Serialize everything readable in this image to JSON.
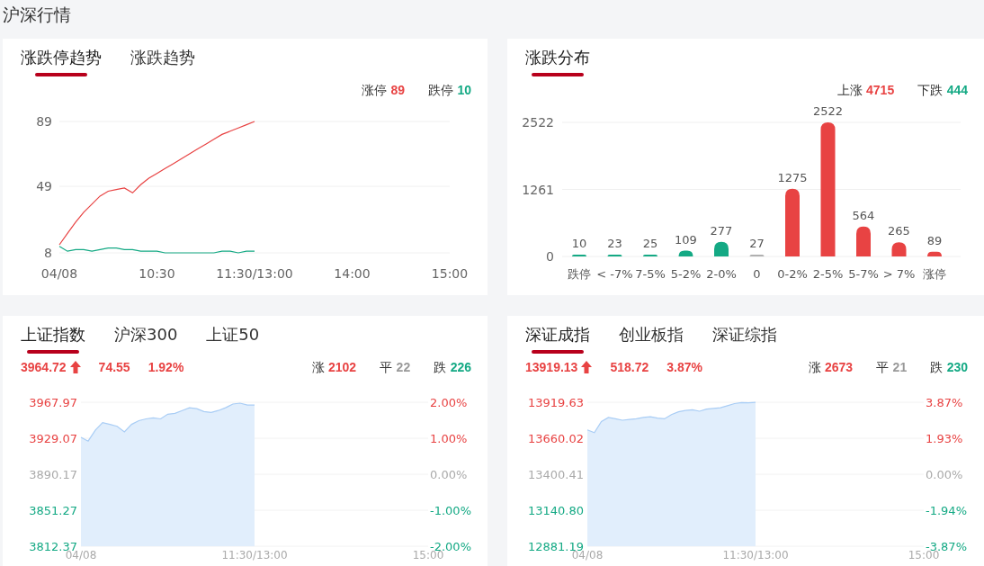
{
  "page_title": "沪深行情",
  "limit_panel": {
    "tabs": [
      {
        "label": "涨跌停趋势",
        "selected": true
      },
      {
        "label": "涨跌趋势",
        "selected": false
      }
    ],
    "legend": [
      {
        "label": "涨停",
        "value": "89",
        "color": "#e84343"
      },
      {
        "label": "跌停",
        "value": "10",
        "color": "#14a984"
      }
    ],
    "chart_data": {
      "type": "line",
      "categories": [
        "04/08",
        null,
        null,
        null,
        null,
        null,
        null,
        null,
        null,
        null,
        null,
        null,
        "10:30",
        null,
        null,
        null,
        null,
        null,
        null,
        null,
        null,
        null,
        null,
        null,
        "11:30/13:00",
        null,
        null,
        null,
        null,
        null,
        null,
        null,
        null,
        null,
        null,
        null,
        "14:00",
        null,
        null,
        null,
        null,
        null,
        null,
        null,
        null,
        null,
        null,
        null,
        "15:00"
      ],
      "series": [
        {
          "color": "#e84343",
          "values": [
            13,
            20,
            27,
            33,
            38,
            43,
            46,
            47,
            48,
            45,
            50,
            54,
            57,
            60,
            63,
            66,
            69,
            72,
            75,
            78,
            81,
            83,
            85,
            87,
            89,
            null,
            null,
            null,
            null,
            null,
            null,
            null,
            null,
            null,
            null,
            null,
            null,
            null,
            null,
            null,
            null,
            null,
            null,
            null,
            null,
            null,
            null,
            null,
            null
          ]
        },
        {
          "color": "#14a984",
          "values": [
            12,
            9,
            10,
            10,
            9,
            10,
            11,
            11,
            10,
            10,
            9,
            9,
            9,
            8,
            8,
            8,
            8,
            8,
            8,
            8,
            9,
            9,
            8,
            9,
            9,
            null,
            null,
            null,
            null,
            null,
            null,
            null,
            null,
            null,
            null,
            null,
            null,
            null,
            null,
            null,
            null,
            null,
            null,
            null,
            null,
            null,
            null,
            null,
            null
          ]
        }
      ],
      "ylim": [
        8,
        89
      ],
      "yticks": [
        8,
        49,
        89
      ],
      "grid": true
    }
  },
  "distribution_panel": {
    "tabs": [
      {
        "label": "涨跌分布",
        "selected": true
      }
    ],
    "legend": [
      {
        "label": "上涨",
        "value": "4715",
        "color": "#e84343"
      },
      {
        "label": "下跌",
        "value": "444",
        "color": "#14a984"
      }
    ],
    "chart_data": {
      "type": "bar",
      "categories": [
        "跌停",
        "< -7%",
        "7-5%",
        "5-2%",
        "2-0%",
        "0",
        "0-2%",
        "2-5%",
        "5-7%",
        "> 7%",
        "涨停"
      ],
      "series": [
        {
          "color": "#14a984",
          "values": [
            10,
            23,
            25,
            109,
            277,
            null,
            null,
            null,
            null,
            null,
            null
          ]
        },
        {
          "color": "#b0b0b0",
          "values": [
            null,
            null,
            null,
            null,
            null,
            27,
            null,
            null,
            null,
            null,
            null
          ]
        },
        {
          "color": "#e84343",
          "values": [
            null,
            null,
            null,
            null,
            null,
            null,
            1275,
            2522,
            564,
            265,
            89
          ]
        }
      ],
      "stacked": true,
      "data_labels": true,
      "grid": true,
      "ylim": [
        0,
        2522
      ],
      "yticks": [
        0,
        1261,
        2522
      ]
    }
  },
  "index_panels": [
    {
      "tabs": [
        {
          "label": "上证指数",
          "selected": true
        },
        {
          "label": "沪深300",
          "selected": false
        },
        {
          "label": "上证50",
          "selected": false
        }
      ],
      "quote": {
        "price": "3964.72",
        "rising": true,
        "change": "74.55",
        "percent": "1.92%"
      },
      "breadth": [
        {
          "label": "涨",
          "value": "2102",
          "color": "#e84343"
        },
        {
          "label": "平",
          "value": "22",
          "color": "#999999"
        },
        {
          "label": "跌",
          "value": "226",
          "color": "#14a984"
        }
      ],
      "right_axis_labels": [
        "2.00%",
        "1.00%",
        "0.00%",
        "-1.00%",
        "-2.00%"
      ],
      "chart_data": {
        "type": "area",
        "categories": [
          "04/08",
          null,
          null,
          null,
          null,
          null,
          null,
          null,
          null,
          null,
          null,
          null,
          null,
          null,
          null,
          null,
          null,
          null,
          null,
          null,
          null,
          null,
          null,
          null,
          "11:30/13:00",
          null,
          null,
          null,
          null,
          null,
          null,
          null,
          null,
          null,
          null,
          null,
          null,
          null,
          null,
          null,
          null,
          null,
          null,
          null,
          null,
          null,
          null,
          null,
          "15:00"
        ],
        "series": [
          {
            "color": "#a9cdf5",
            "values": [
              3930,
              3926,
              3938,
              3946,
              3944,
              3942,
              3936,
              3944,
              3948,
              3950,
              3951,
              3950,
              3955,
              3956,
              3959,
              3962,
              3961,
              3958,
              3957,
              3959,
              3962,
              3966,
              3967,
              3965,
              3965,
              null,
              null,
              null,
              null,
              null,
              null,
              null,
              null,
              null,
              null,
              null,
              null,
              null,
              null,
              null,
              null,
              null,
              null,
              null,
              null,
              null,
              null,
              null,
              null
            ]
          }
        ],
        "grid": true,
        "ylim": [
          3812.37,
          3967.97
        ],
        "yticks": [
          {
            "value": 3812.37,
            "label": "3812.37"
          },
          {
            "value": 3851.27,
            "label": "3851.27"
          },
          {
            "value": 3890.17,
            "label": "3890.17"
          },
          {
            "value": 3929.07,
            "label": "3929.07"
          },
          {
            "value": 3967.97,
            "label": "3967.97"
          }
        ]
      }
    },
    {
      "tabs": [
        {
          "label": "深证成指",
          "selected": true
        },
        {
          "label": "创业板指",
          "selected": false
        },
        {
          "label": "深证综指",
          "selected": false
        }
      ],
      "quote": {
        "price": "13919.13",
        "rising": true,
        "change": "518.72",
        "percent": "3.87%"
      },
      "breadth": [
        {
          "label": "涨",
          "value": "2673",
          "color": "#e84343"
        },
        {
          "label": "平",
          "value": "21",
          "color": "#999999"
        },
        {
          "label": "跌",
          "value": "230",
          "color": "#14a984"
        }
      ],
      "right_axis_labels": [
        "3.87%",
        "1.93%",
        "0.00%",
        "-1.94%",
        "-3.87%"
      ],
      "chart_data": {
        "type": "area",
        "categories": [
          "04/08",
          null,
          null,
          null,
          null,
          null,
          null,
          null,
          null,
          null,
          null,
          null,
          null,
          null,
          null,
          null,
          null,
          null,
          null,
          null,
          null,
          null,
          null,
          null,
          "11:30/13:00",
          null,
          null,
          null,
          null,
          null,
          null,
          null,
          null,
          null,
          null,
          null,
          null,
          null,
          null,
          null,
          null,
          null,
          null,
          null,
          null,
          null,
          null,
          null,
          "15:00"
        ],
        "series": [
          {
            "color": "#a9cdf5",
            "values": [
              13720,
              13700,
              13780,
              13810,
              13800,
              13790,
              13795,
              13800,
              13810,
              13815,
              13805,
              13800,
              13830,
              13850,
              13860,
              13865,
              13855,
              13870,
              13875,
              13880,
              13895,
              13910,
              13918,
              13915,
              13919,
              null,
              null,
              null,
              null,
              null,
              null,
              null,
              null,
              null,
              null,
              null,
              null,
              null,
              null,
              null,
              null,
              null,
              null,
              null,
              null,
              null,
              null,
              null,
              null
            ]
          }
        ],
        "grid": true,
        "ylim": [
          12881.19,
          13919.63
        ],
        "yticks": [
          {
            "value": 12881.19,
            "label": "12881.19"
          },
          {
            "value": 13140.8,
            "label": "13140.80"
          },
          {
            "value": 13400.41,
            "label": "13400.41"
          },
          {
            "value": 13660.02,
            "label": "13660.02"
          },
          {
            "value": 13919.63,
            "label": "13919.63"
          }
        ]
      }
    }
  ]
}
